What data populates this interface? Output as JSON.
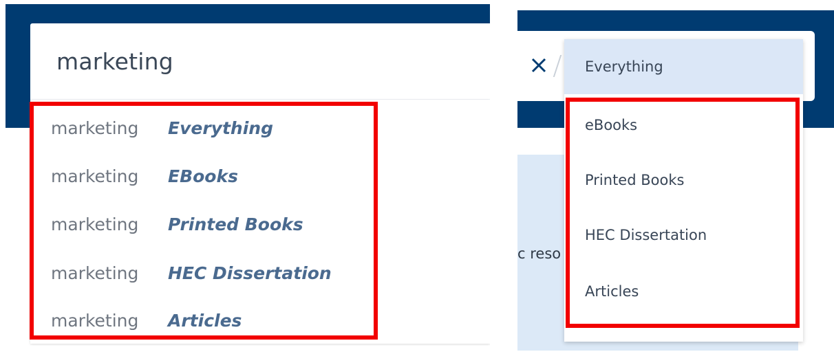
{
  "left_panel": {
    "search": {
      "value": "marketing"
    },
    "suggestions": [
      {
        "term": "marketing",
        "scope": "Everything"
      },
      {
        "term": "marketing",
        "scope": "EBooks"
      },
      {
        "term": "marketing",
        "scope": "Printed Books"
      },
      {
        "term": "marketing",
        "scope": "HEC Dissertation"
      },
      {
        "term": "marketing",
        "scope": "Articles"
      }
    ]
  },
  "right_panel": {
    "close_icon": "close-icon",
    "background_text": "c reso",
    "dropdown": {
      "selected": "Everything",
      "items": [
        "Everything",
        "eBooks",
        "Printed Books",
        "HEC Dissertation",
        "Articles"
      ]
    }
  },
  "colors": {
    "header_navy": "#003b71",
    "highlight_red": "#f20000",
    "scope_text": "#4a6a8f",
    "selected_item_bg": "#dbe7f7"
  }
}
